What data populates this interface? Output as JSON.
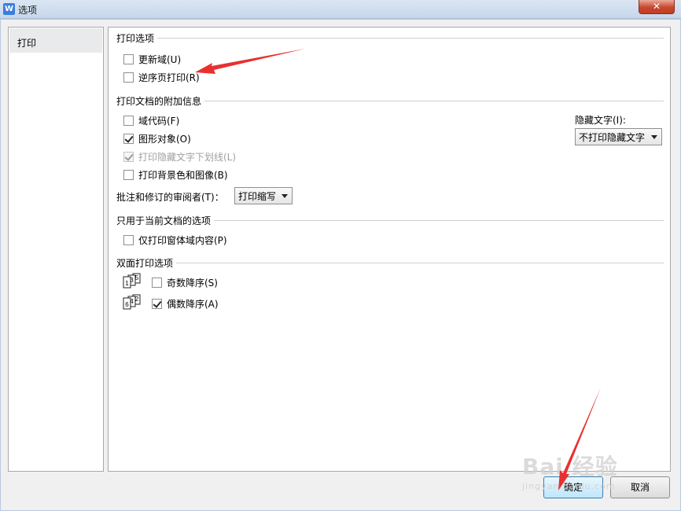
{
  "window": {
    "title": "选项",
    "app_icon": "W",
    "close_label": "✕"
  },
  "sidebar": {
    "items": [
      {
        "label": "打印",
        "selected": true
      }
    ]
  },
  "print_options": {
    "header": "打印选项",
    "update_fields": {
      "label": "更新域(U)",
      "checked": false
    },
    "reverse_order": {
      "label": "逆序页打印(R)",
      "checked": false
    }
  },
  "additional_info": {
    "header": "打印文档的附加信息",
    "field_codes": {
      "label": "域代码(F)",
      "checked": false
    },
    "drawing_objects": {
      "label": "图形对象(O)",
      "checked": true
    },
    "hidden_text_underline": {
      "label": "打印隐藏文字下划线(L)",
      "checked": true,
      "disabled": true
    },
    "background": {
      "label": "打印背景色和图像(B)",
      "checked": false
    },
    "reviewer_label": "批注和修订的审阅者(T)：",
    "reviewer_value": "打印缩写",
    "hidden_text_label": "隐藏文字(I):",
    "hidden_text_value": "不打印隐藏文字"
  },
  "current_doc": {
    "header": "只用于当前文档的选项",
    "form_fields_only": {
      "label": "仅打印窗体域内容(P)",
      "checked": false
    }
  },
  "duplex": {
    "header": "双面打印选项",
    "odd_reverse": {
      "label": "奇数降序(S)",
      "checked": false,
      "icon_digits": [
        "1",
        "3",
        "5"
      ]
    },
    "even_reverse": {
      "label": "偶数降序(A)",
      "checked": true,
      "icon_digits": [
        "6",
        "4",
        "2"
      ]
    }
  },
  "buttons": {
    "ok": "确定",
    "cancel": "取消"
  },
  "watermark": {
    "text": "Bai 经验",
    "sub": "jingyan.baidu.com"
  },
  "colors": {
    "annotation_arrow": "#e8312f",
    "titlebar": "#c6d6ea",
    "close_button": "#c8472e"
  }
}
